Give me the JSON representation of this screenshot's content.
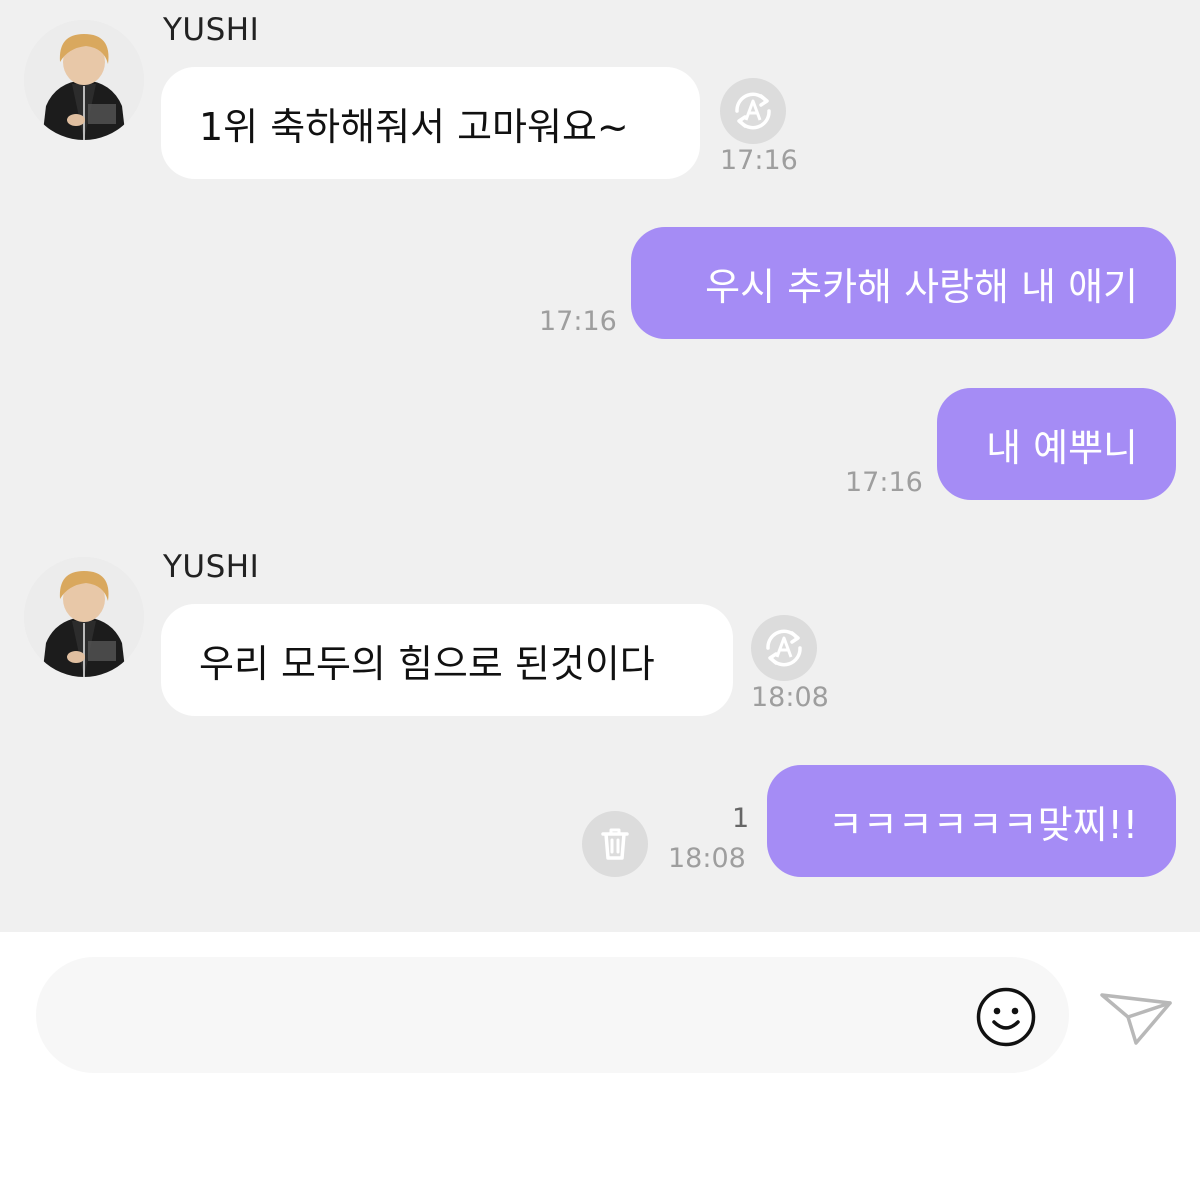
{
  "conversation": {
    "messages": [
      {
        "sender": "YUSHI",
        "text": "1위 축하해줘서 고마워요~",
        "time": "17:16"
      },
      {
        "text": "우시 추카해 사랑해 내 애기",
        "time": "17:16"
      },
      {
        "text": "내 예뿌니",
        "time": "17:16"
      },
      {
        "sender": "YUSHI",
        "text": "우리 모두의 힘으로 된것이다",
        "time": "18:08"
      },
      {
        "text": "ㅋㅋㅋㅋㅋㅋ맞찌!!",
        "time": "18:08",
        "unread": "1"
      }
    ]
  },
  "icons": {
    "translate": "translate-icon",
    "delete": "trash-icon",
    "emoji": "smiley-icon",
    "send": "paper-plane-icon"
  },
  "composer": {
    "placeholder": ""
  },
  "colors": {
    "chat_background": "#f0f0f0",
    "incoming_bubble": "#ffffff",
    "outgoing_bubble": "#a58cf5",
    "timestamp": "#9e9e9e"
  }
}
